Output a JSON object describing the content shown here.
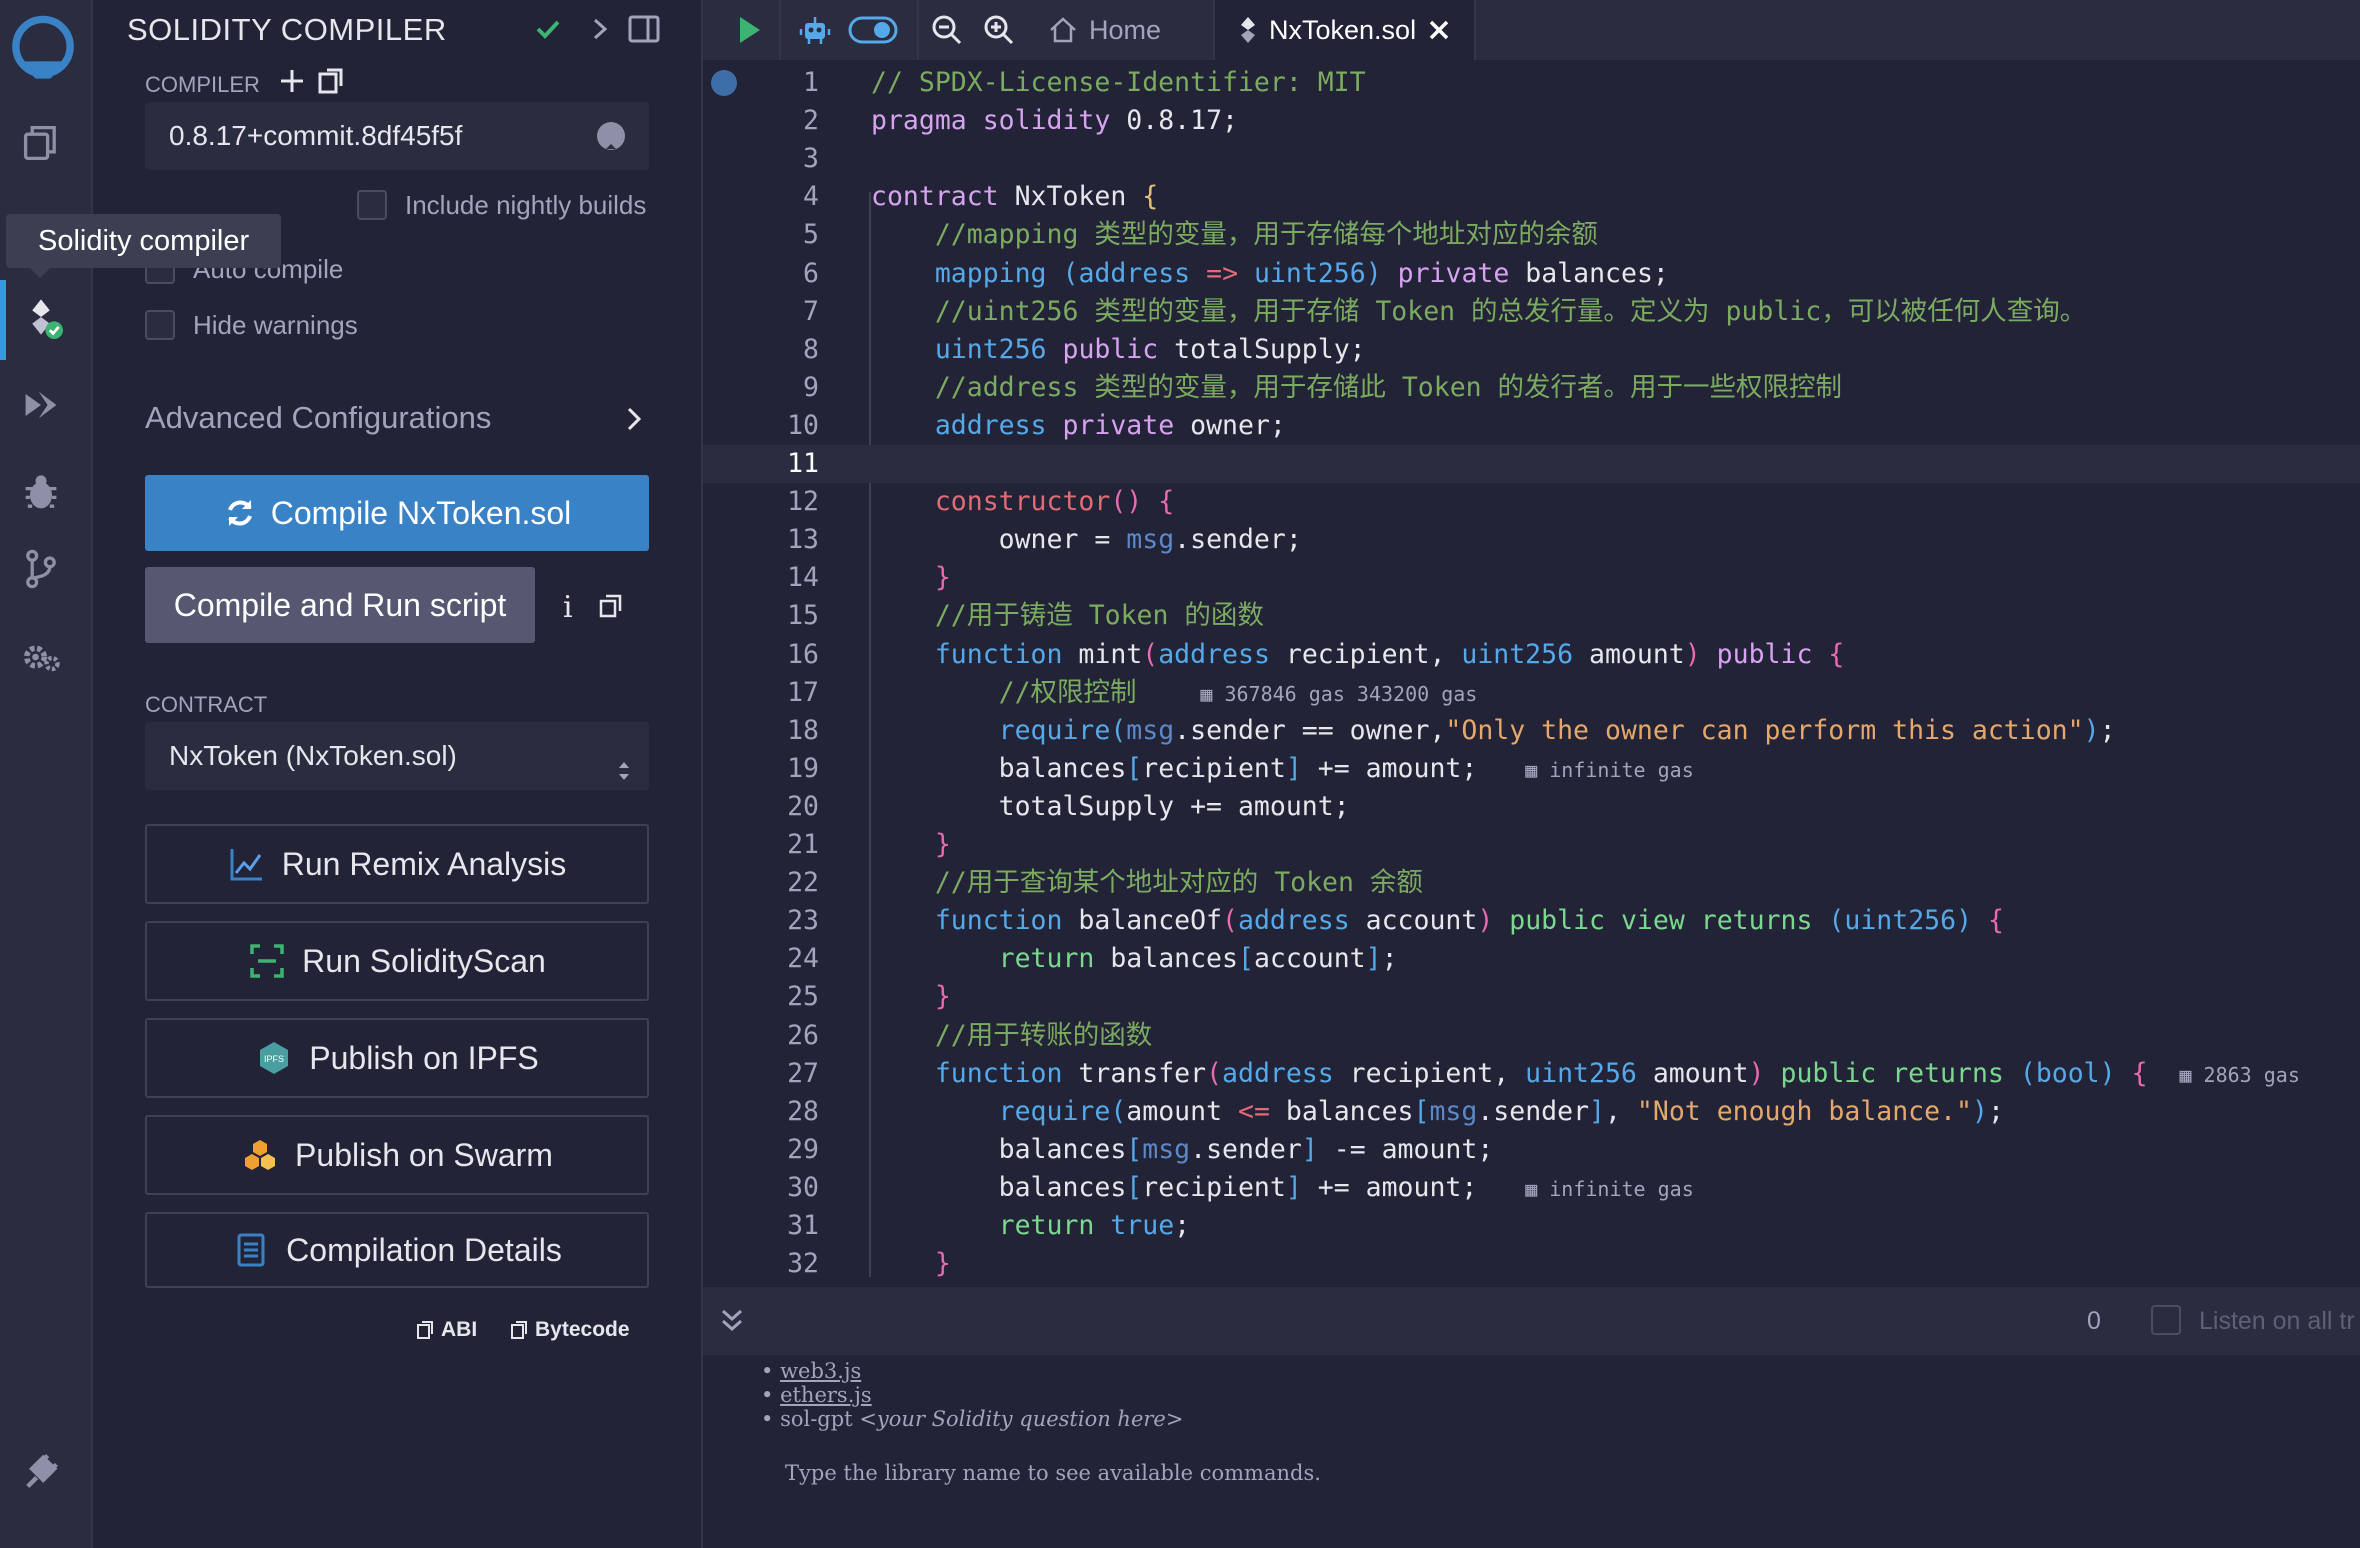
{
  "side_panel": {
    "title": "SOLIDITY COMPILER",
    "compiler_label": "COMPILER",
    "compiler_version": "0.8.17+commit.8df45f5f",
    "include_nightly": "Include nightly builds",
    "auto_compile": "Auto compile",
    "hide_warnings": "Hide warnings",
    "advanced": "Advanced Configurations",
    "compile_button": "Compile NxToken.sol",
    "compile_run_button": "Compile and Run script",
    "info_glyph": "i",
    "contract_label": "CONTRACT",
    "contract_value": "NxToken (NxToken.sol)",
    "run_remix_analysis": "Run Remix Analysis",
    "run_solidityscan": "Run SolidityScan",
    "publish_ipfs": "Publish on IPFS",
    "publish_swarm": "Publish on Swarm",
    "compilation_details": "Compilation Details",
    "abi": "ABI",
    "bytecode": "Bytecode",
    "ipfs_icon_text": "IPFS"
  },
  "tooltip": "Solidity compiler",
  "tabs": {
    "home": "Home",
    "file": "NxToken.sol"
  },
  "code_lines": [
    "1",
    "2",
    "3",
    "4",
    "5",
    "6",
    "7",
    "8",
    "9",
    "10",
    "11",
    "12",
    "13",
    "14",
    "15",
    "16",
    "17",
    "18",
    "19",
    "20",
    "21",
    "22",
    "23",
    "24",
    "25",
    "26",
    "27",
    "28",
    "29",
    "30",
    "31",
    "32"
  ],
  "current_line": "11",
  "gas": {
    "mint": "367846 gas 343200 gas",
    "line19": "infinite gas",
    "transfer": "2863 gas",
    "line30": "infinite gas"
  },
  "terminal": {
    "count": "0",
    "listen": "Listen on all tr",
    "items": [
      "web3.js",
      "ethers.js",
      "sol-gpt"
    ],
    "sol_gpt_hint": "<your Solidity question here>",
    "footer": "Type the library name to see available commands."
  },
  "colors": {
    "accent": "#3a82c6",
    "background": "#222336",
    "panel": "#2a2c3f",
    "success": "#3cb371"
  }
}
